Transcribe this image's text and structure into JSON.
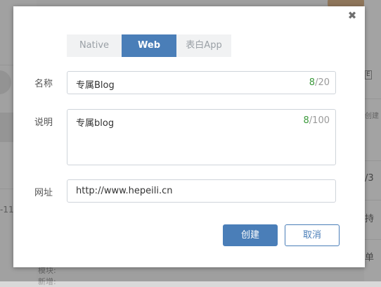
{
  "background": {
    "left_fragment": "-11",
    "bottom_lines": [
      "模块:",
      "新增:"
    ],
    "right_fragments": [
      "E",
      "创建",
      "/3",
      "持",
      "单"
    ]
  },
  "dialog": {
    "close_glyph": "✖",
    "tabs": [
      {
        "label": "Native",
        "active": false
      },
      {
        "label": "Web",
        "active": true
      },
      {
        "label": "表白App",
        "active": false
      }
    ],
    "fields": {
      "name": {
        "label": "名称",
        "value": "专属Blog",
        "count": "8",
        "max": "/20"
      },
      "description": {
        "label": "说明",
        "value": "专属blog",
        "count": "8",
        "max": "/100"
      },
      "url": {
        "label": "网址",
        "value": "http://www.hepeili.cn"
      }
    },
    "buttons": {
      "create": "创建",
      "cancel": "取消"
    }
  },
  "colors": {
    "primary": "#4a7eb8",
    "counter_current": "#3c9a3c",
    "overlay": "rgba(0,0,0,0.34)"
  }
}
